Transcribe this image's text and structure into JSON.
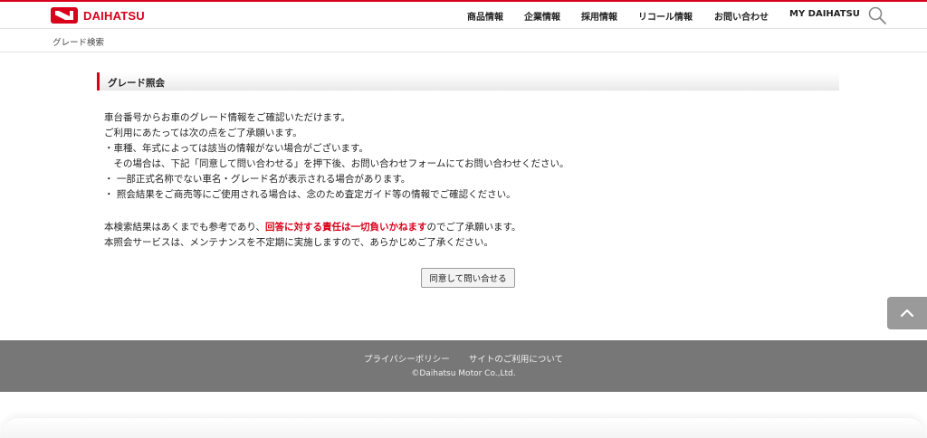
{
  "brand": {
    "name": "DAIHATSU",
    "accent": "#d9001b"
  },
  "nav": {
    "items": [
      "商品情報",
      "企業情報",
      "採用情報",
      "リコール情報",
      "お問い合わせ",
      "MY DAIHATSU"
    ]
  },
  "breadcrumb": "グレード検索",
  "section": {
    "title": "グレード照会"
  },
  "notice": {
    "line1": "車台番号からお車のグレード情報をご確認いただけます。",
    "line2": "ご利用にあたっては次の点をご了承願います。",
    "line3": "・車種、年式によっては該当の情報がない場合がございます。",
    "line4": "　その場合は、下記「同意して問い合わせる」を押下後、お問い合わせフォームにてお問い合わせください。",
    "line5": "・ 一部正式名称でない車名・グレード名が表示される場合があります。",
    "line6": "・ 照会結果をご商売等にご使用される場合は、念のため査定ガイド等の情報でご確認ください。",
    "disclaimer_pre": "本検索結果はあくまでも参考であり、",
    "disclaimer_highlight": "回答に対する責任は一切負いかねます",
    "disclaimer_post": "のでご了承願います。",
    "maintenance": "本照会サービスは、メンテナンスを不定期に実施しますので、あらかじめご了承ください。"
  },
  "button": {
    "label": "同意して問い合せる"
  },
  "footer": {
    "links": [
      "プライバシーポリシー",
      "サイトのご利用について"
    ],
    "copyright": "©Daihatsu Motor Co.,Ltd."
  },
  "icons": {
    "search": "search-icon",
    "back_to_top": "chevron-up-icon",
    "logo": "daihatsu-logo-icon"
  }
}
